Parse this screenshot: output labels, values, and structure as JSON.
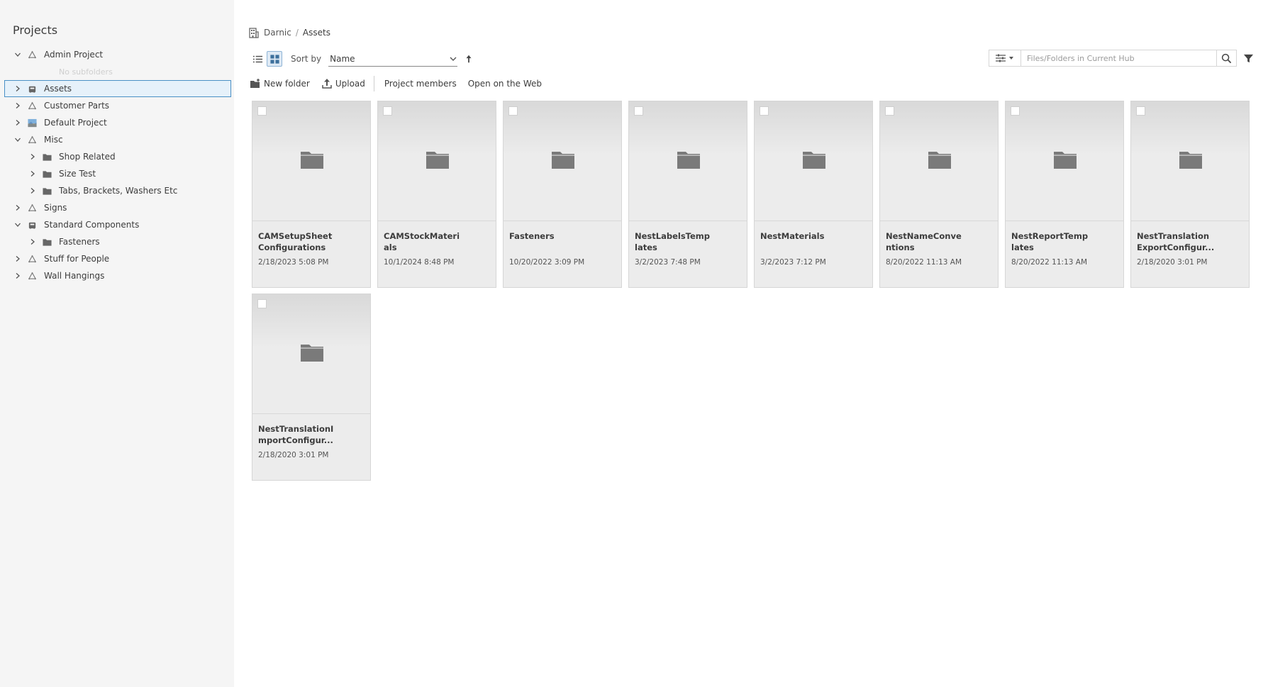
{
  "sidebar": {
    "title": "Projects",
    "tree": [
      {
        "label": "Admin Project",
        "level": 0,
        "chevron": "down",
        "icon": "project-icon"
      },
      {
        "label": "No subfolders",
        "level": 1,
        "chevron": "none",
        "icon": "none",
        "empty": true
      },
      {
        "label": "Assets",
        "level": 0,
        "chevron": "right",
        "icon": "hub-icon",
        "selected": true
      },
      {
        "label": "Customer Parts",
        "level": 0,
        "chevron": "right",
        "icon": "project-icon"
      },
      {
        "label": "Default Project",
        "level": 0,
        "chevron": "right",
        "icon": "image-icon"
      },
      {
        "label": "Misc",
        "level": 0,
        "chevron": "down",
        "icon": "project-icon"
      },
      {
        "label": "Shop Related",
        "level": 1,
        "chevron": "right",
        "icon": "folder-icon"
      },
      {
        "label": "Size Test",
        "level": 1,
        "chevron": "right",
        "icon": "folder-icon"
      },
      {
        "label": "Tabs, Brackets, Washers Etc",
        "level": 1,
        "chevron": "right",
        "icon": "folder-icon"
      },
      {
        "label": "Signs",
        "level": 0,
        "chevron": "right",
        "icon": "project-icon"
      },
      {
        "label": "Standard Components",
        "level": 0,
        "chevron": "down",
        "icon": "hub-icon"
      },
      {
        "label": "Fasteners",
        "level": 1,
        "chevron": "right",
        "icon": "folder-icon"
      },
      {
        "label": "Stuff for People",
        "level": 0,
        "chevron": "right",
        "icon": "project-icon"
      },
      {
        "label": "Wall Hangings",
        "level": 0,
        "chevron": "right",
        "icon": "project-icon"
      }
    ]
  },
  "breadcrumb": {
    "hub": "Darnic",
    "separator": "/",
    "current": "Assets"
  },
  "toolbar": {
    "sort_label": "Sort by",
    "sort_value": "Name",
    "new_folder": "New folder",
    "upload": "Upload",
    "project_members": "Project members",
    "open_web": "Open on the Web"
  },
  "search": {
    "placeholder": "Files/Folders in Current Hub",
    "value": ""
  },
  "items": [
    {
      "name": [
        "CAMSetupSheet",
        "Configurations"
      ],
      "date": "2/18/2023 5:08 PM"
    },
    {
      "name": [
        "CAMStockMateri",
        "als"
      ],
      "date": "10/1/2024 8:48 PM"
    },
    {
      "name": [
        "Fasteners"
      ],
      "date": "10/20/2022 3:09 PM"
    },
    {
      "name": [
        "NestLabelsTemp",
        "lates"
      ],
      "date": "3/2/2023 7:48 PM"
    },
    {
      "name": [
        "NestMaterials"
      ],
      "date": "3/2/2023 7:12 PM"
    },
    {
      "name": [
        "NestNameConve",
        "ntions"
      ],
      "date": "8/20/2022 11:13 AM"
    },
    {
      "name": [
        "NestReportTemp",
        "lates"
      ],
      "date": "8/20/2022 11:13 AM"
    },
    {
      "name": [
        "NestTranslation",
        "ExportConfigur..."
      ],
      "date": "2/18/2020 3:01 PM"
    },
    {
      "name": [
        "NestTranslationI",
        "mportConfigur..."
      ],
      "date": "2/18/2020 3:01 PM"
    }
  ],
  "colors": {
    "sidebar_bg": "#f5f5f5",
    "selected_bg": "#e6f1fa",
    "selected_border": "#4a90c6",
    "card_bg": "#ececec",
    "folder_icon": "#7a7a7a"
  }
}
